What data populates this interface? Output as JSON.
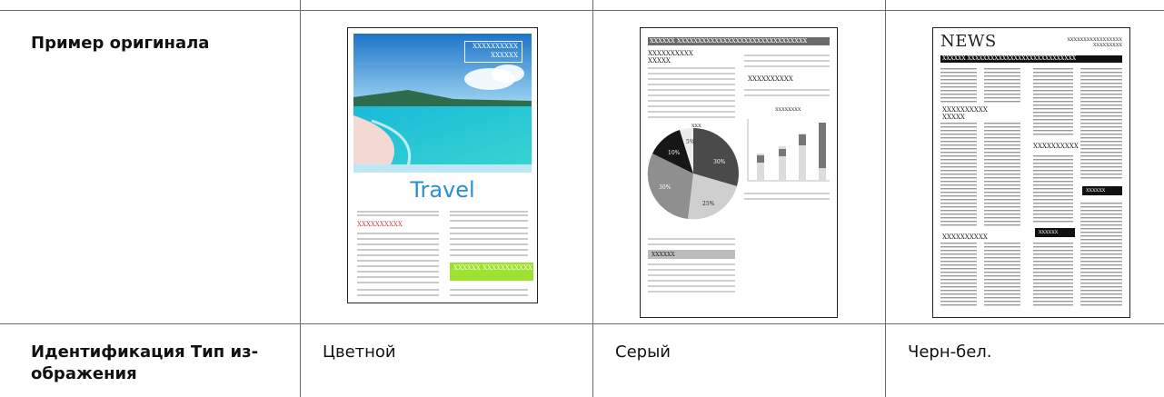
{
  "table": {
    "row1_label": "Пример оригинала",
    "row2_label": "Идентификация Тип из-\nображения",
    "values": [
      "Цветной",
      "Серый",
      "Черн-бел."
    ]
  },
  "samples": {
    "color": {
      "banner_text": "XXXXXXXXXX\nXXXXXX",
      "title": "Travel",
      "red_heading": "XXXXXXXXXX",
      "green_text": "XXXXXX XXXXXXXXXXX"
    },
    "gray": {
      "header_bar": "XXXXXX XXXXXXXXXXXXXXXXXXXXXXXXXXXXXXX",
      "heading_left": "XXXXXXXXXX\nXXXXX",
      "heading_right": "XXXXXXXXXX",
      "pie_title": "XXX",
      "bars_title": "XXXXXXXX",
      "pie_labels": [
        "5%",
        "10%",
        "30%",
        "30%",
        "25%"
      ],
      "bottom_bar": "XXXXXX"
    },
    "bw": {
      "masthead": "NEWS",
      "masthead_right": "XXXXXXXXXXXXXXXXX\nXXXXXXXXX",
      "black_bar": "XXXXXX XXXXXXXXXXXXXXXXXXXXXXXXXXXX",
      "heading1": "XXXXXXXXXX\nXXXXX",
      "heading2": "XXXXXXXXXX",
      "heading3": "XXXXXXXXXX",
      "black_tag1": "XXXXXX",
      "black_tag2": "XXXXXX"
    }
  }
}
